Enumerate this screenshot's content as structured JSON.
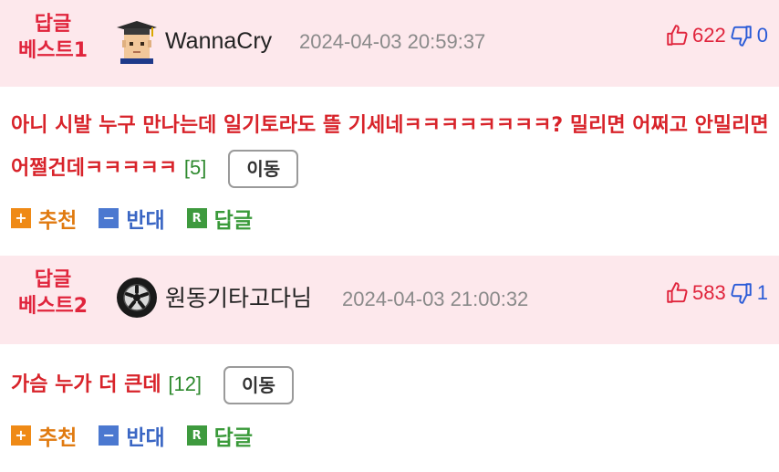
{
  "comments": [
    {
      "badge_line1": "답글",
      "badge_line2": "베스트1",
      "author": "WannaCry",
      "avatar_icon": "pixel-face-graduation-cap-icon",
      "timestamp": "2024-04-03 20:59:37",
      "upvotes": "622",
      "downvotes": "0",
      "text": "아니 시발 누구 만나는데 일기토라도 뜰 기세네ㅋㅋㅋㅋㅋㅋㅋㅋ? 밀리면 어쩌고 안밀리면 어쩔건데ㅋㅋㅋㅋㅋ",
      "reply_count": "[5]",
      "move_label": "이동",
      "actions": {
        "recommend": "추천",
        "oppose": "반대",
        "reply": "답글",
        "reply_icon_letter": "R"
      }
    },
    {
      "badge_line1": "답글",
      "badge_line2": "베스트2",
      "author": "원동기타고다님",
      "avatar_icon": "tire-wheel-icon",
      "timestamp": "2024-04-03 21:00:32",
      "upvotes": "583",
      "downvotes": "1",
      "text": "가슴 누가 더 큰데",
      "reply_count": "[12]",
      "move_label": "이동",
      "actions": {
        "recommend": "추천",
        "oppose": "반대",
        "reply": "답글",
        "reply_icon_letter": "R"
      }
    }
  ],
  "colors": {
    "header_bg": "#fde8ec",
    "badge": "#e0243c",
    "comment_text": "#d8232a",
    "upvote": "#e0243c",
    "downvote": "#2a5bd7",
    "reply_count": "#2f8a2f"
  }
}
